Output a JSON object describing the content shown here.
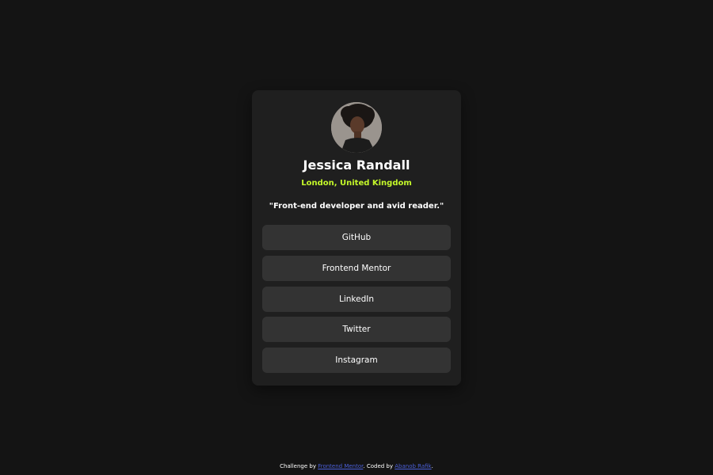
{
  "profile": {
    "name": "Jessica Randall",
    "location": "London, United Kingdom",
    "bio": "\"Front-end developer and avid reader.\""
  },
  "links": [
    {
      "label": "GitHub"
    },
    {
      "label": "Frontend Mentor"
    },
    {
      "label": "LinkedIn"
    },
    {
      "label": "Twitter"
    },
    {
      "label": "Instagram"
    }
  ],
  "footer": {
    "prefix": "Challenge by ",
    "challenge_link": "Frontend Mentor",
    "middle": ". Coded by ",
    "author_link": "Abanob Rafik",
    "suffix": "."
  },
  "colors": {
    "background": "#141414",
    "card": "#1f1f1f",
    "button": "#333333",
    "accent": "#c4f82a",
    "link": "#4a5fd8"
  },
  "icons": {
    "avatar": "profile-photo"
  }
}
